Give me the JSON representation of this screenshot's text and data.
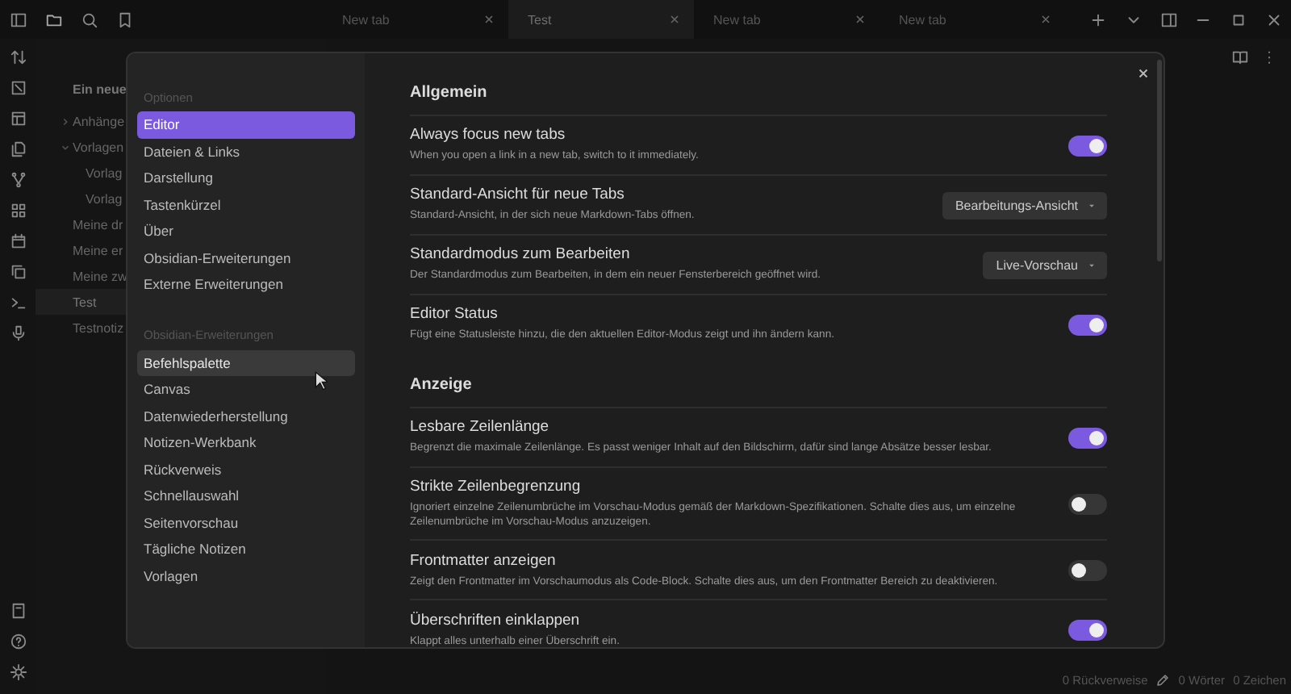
{
  "tabs": [
    {
      "label": "New tab",
      "selected": false
    },
    {
      "label": "Test",
      "selected": true
    },
    {
      "label": "New tab",
      "selected": false
    },
    {
      "label": "New tab",
      "selected": false
    }
  ],
  "explorer": {
    "vault": "Ein neue",
    "items": [
      {
        "kind": "folder",
        "label": "Anhänge",
        "expanded": false,
        "selected": false
      },
      {
        "kind": "folder",
        "label": "Vorlagen",
        "expanded": true,
        "selected": false,
        "children": [
          {
            "label": "Vorlag",
            "selected": false
          },
          {
            "label": "Vorlag",
            "selected": false
          }
        ]
      },
      {
        "kind": "file",
        "label": "Meine dr",
        "selected": false
      },
      {
        "kind": "file",
        "label": "Meine er",
        "selected": false
      },
      {
        "kind": "file",
        "label": "Meine zw",
        "selected": false
      },
      {
        "kind": "file",
        "label": "Test",
        "selected": true
      },
      {
        "kind": "file",
        "label": "Testnotiz",
        "selected": false
      }
    ]
  },
  "settings": {
    "nav": [
      {
        "heading": "Optionen",
        "items": [
          {
            "label": "Editor",
            "selected": true,
            "hovered": false
          },
          {
            "label": "Dateien & Links",
            "selected": false,
            "hovered": false
          },
          {
            "label": "Darstellung",
            "selected": false,
            "hovered": false
          },
          {
            "label": "Tastenkürzel",
            "selected": false,
            "hovered": false
          },
          {
            "label": "Über",
            "selected": false,
            "hovered": false
          },
          {
            "label": "Obsidian-Erweiterungen",
            "selected": false,
            "hovered": false
          },
          {
            "label": "Externe Erweiterungen",
            "selected": false,
            "hovered": false
          }
        ]
      },
      {
        "heading": "Obsidian-Erweiterungen",
        "items": [
          {
            "label": "Befehlspalette",
            "selected": false,
            "hovered": true
          },
          {
            "label": "Canvas",
            "selected": false,
            "hovered": false
          },
          {
            "label": "Datenwiederherstellung",
            "selected": false,
            "hovered": false
          },
          {
            "label": "Notizen-Werkbank",
            "selected": false,
            "hovered": false
          },
          {
            "label": "Rückverweis",
            "selected": false,
            "hovered": false
          },
          {
            "label": "Schnellauswahl",
            "selected": false,
            "hovered": false
          },
          {
            "label": "Seitenvorschau",
            "selected": false,
            "hovered": false
          },
          {
            "label": "Tägliche Notizen",
            "selected": false,
            "hovered": false
          },
          {
            "label": "Vorlagen",
            "selected": false,
            "hovered": false
          }
        ]
      }
    ],
    "sections": [
      {
        "heading": "Allgemein",
        "items": [
          {
            "name": "Always focus new tabs",
            "description": "When you open a link in a new tab, switch to it immediately.",
            "kind": "toggle",
            "on": true
          },
          {
            "name": "Standard-Ansicht für neue Tabs",
            "description": "Standard-Ansicht, in der sich neue Markdown-Tabs öffnen.",
            "kind": "dropdown",
            "value": "Bearbeitungs-Ansicht"
          },
          {
            "name": "Standardmodus zum Bearbeiten",
            "description": "Der Standardmodus zum Bearbeiten, in dem ein neuer Fensterbereich geöffnet wird.",
            "kind": "dropdown",
            "value": "Live-Vorschau"
          },
          {
            "name": "Editor Status",
            "description": "Fügt eine Statusleiste hinzu, die den aktuellen Editor-Modus zeigt und ihn ändern kann.",
            "kind": "toggle",
            "on": true
          }
        ]
      },
      {
        "heading": "Anzeige",
        "items": [
          {
            "name": "Lesbare Zeilenlänge",
            "description": "Begrenzt die maximale Zeilenlänge. Es passt weniger Inhalt auf den Bildschirm, dafür sind lange Absätze besser lesbar.",
            "kind": "toggle",
            "on": true
          },
          {
            "name": "Strikte Zeilenbegrenzung",
            "description": "Ignoriert einzelne Zeilenumbrüche im Vorschau-Modus gemäß der Markdown-Spezifikationen. Schalte dies aus, um einzelne Zeilenumbrüche im Vorschau-Modus anzuzeigen.",
            "kind": "toggle",
            "on": false
          },
          {
            "name": "Frontmatter anzeigen",
            "description": "Zeigt den Frontmatter im Vorschaumodus als Code-Block. Schalte dies aus, um den Frontmatter Bereich zu deaktivieren.",
            "kind": "toggle",
            "on": false
          },
          {
            "name": "Überschriften einklappen",
            "description": "Klappt alles unterhalb einer Überschrift ein.",
            "kind": "toggle",
            "on": true
          }
        ]
      }
    ]
  },
  "status_bar": {
    "backlinks": "0 Rückverweise",
    "words": "0 Wörter",
    "characters": "0 Zeichen"
  }
}
